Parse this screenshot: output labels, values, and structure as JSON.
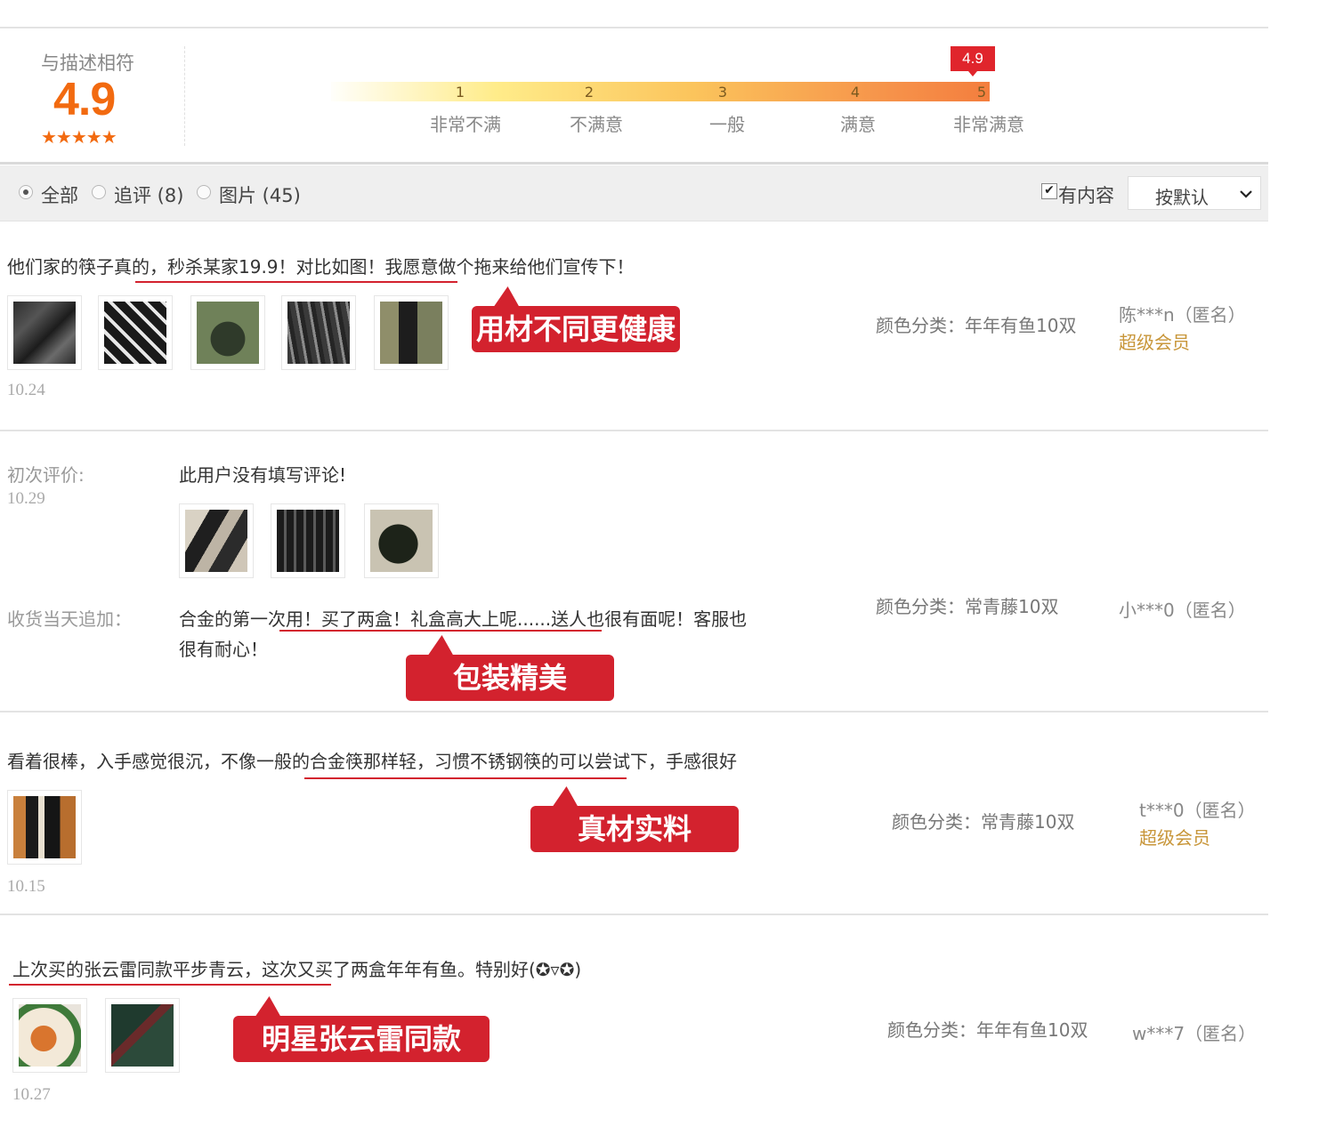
{
  "rating": {
    "title": "与描述相符",
    "score": "4.9",
    "stars": "★★★★★",
    "flag": "4.9",
    "ticks": [
      {
        "num": "1",
        "label": "非常不满"
      },
      {
        "num": "2",
        "label": "不满意"
      },
      {
        "num": "3",
        "label": "一般"
      },
      {
        "num": "4",
        "label": "满意"
      },
      {
        "num": "5",
        "label": "非常满意"
      }
    ],
    "colors": {
      "accent": "#f26a10",
      "flag": "#e0252c"
    }
  },
  "filters": {
    "all": "全部",
    "followup": "追评 (8)",
    "images": "图片 (45)",
    "has_content": "有内容",
    "checkbox_mark": "✔",
    "sort": "按默认",
    "sort_icon": "chevron-down-icon"
  },
  "reviews": [
    {
      "text": "他们家的筷子真的，秒杀某家19.9！对比如图！我愿意做个拖来给他们宣传下！",
      "date": "10.24",
      "sku": "颜色分类：年年有鱼10双",
      "user": "陈***n（匿名）",
      "member": "超级会员",
      "tag": "用材不同更健康"
    },
    {
      "first_label": "初次评价:",
      "first_date": "10.29",
      "first_text": "此用户没有填写评论!",
      "append_label": "收货当天追加：",
      "append_text_1": "合金的第一次用！买了两盒！礼盒高大上呢......送人也很有面呢！客服也",
      "append_text_2": "很有耐心！",
      "sku": "颜色分类：常青藤10双",
      "user": "小***0（匿名）",
      "tag": "包装精美"
    },
    {
      "text": "看着很棒，入手感觉很沉，不像一般的合金筷那样轻，习惯不锈钢筷的可以尝试下，手感很好",
      "date": "10.15",
      "sku": "颜色分类：常青藤10双",
      "user": "t***0（匿名）",
      "member": "超级会员",
      "tag": "真材实料"
    },
    {
      "text": "上次买的张云雷同款平步青云，这次又买了两盒年年有鱼。特别好(✪▿✪)",
      "date": "10.27",
      "sku": "颜色分类：年年有鱼10双",
      "user": "w***7（匿名）",
      "tag": "明星张云雷同款"
    }
  ]
}
